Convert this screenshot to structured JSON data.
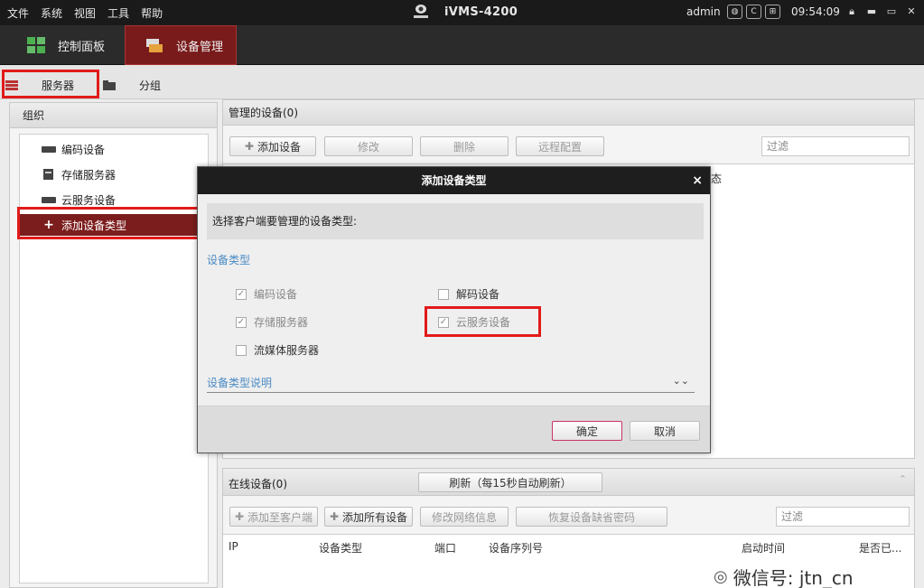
{
  "menu": [
    "文件",
    "系统",
    "视图",
    "工具",
    "帮助"
  ],
  "app_title": "iVMS-4200",
  "user": "admin",
  "clock": "09:54:09",
  "status_icons": [
    "globe",
    "CPU",
    "network"
  ],
  "module_tabs": [
    {
      "label": "控制面板",
      "active": false
    },
    {
      "label": "设备管理",
      "active": true
    }
  ],
  "sub_tabs": [
    {
      "label": "服务器",
      "active": true
    },
    {
      "label": "分组",
      "active": false
    }
  ],
  "left_panel": {
    "title": "组织",
    "items": [
      {
        "label": "编码设备",
        "icon": "encoder-icon"
      },
      {
        "label": "存储服务器",
        "icon": "storage-icon"
      },
      {
        "label": "云服务设备",
        "icon": "cloud-icon"
      },
      {
        "label": "添加设备类型",
        "icon": "plus-icon",
        "selected": true
      }
    ]
  },
  "managed": {
    "title": "管理的设备(0)",
    "buttons": {
      "add": "添加设备",
      "modify": "修改",
      "delete": "删除",
      "remote": "远程配置"
    },
    "filter_placeholder": "过滤",
    "col_fragment": "态"
  },
  "online": {
    "title": "在线设备(0)",
    "refresh": "刷新（每15秒自动刷新）",
    "buttons": {
      "add_client": "添加至客户端",
      "add_all": "添加所有设备",
      "modify_net": "修改网络信息",
      "restore_pwd": "恢复设备缺省密码"
    },
    "filter_placeholder": "过滤",
    "columns": [
      "IP",
      "设备类型",
      "端口",
      "设备序列号",
      "启动时间",
      "是否已..."
    ]
  },
  "modal": {
    "title": "添加设备类型",
    "close": "×",
    "desc": "选择客户端要管理的设备类型:",
    "section": "设备类型",
    "options": [
      {
        "label": "编码设备",
        "checked": true,
        "disabled": true
      },
      {
        "label": "存储服务器",
        "checked": true,
        "disabled": true
      },
      {
        "label": "流媒体服务器",
        "checked": false,
        "disabled": false
      },
      {
        "label": "解码设备",
        "checked": false,
        "disabled": false
      },
      {
        "label": "云服务设备",
        "checked": true,
        "disabled": true
      }
    ],
    "explain": "设备类型说明",
    "ok": "确定",
    "cancel": "取消"
  },
  "watermark": "微信号: jtn_cn",
  "colors": {
    "accent": "#7a1b1b",
    "highlight": "#e21a1a",
    "link": "#4a8bc4"
  }
}
